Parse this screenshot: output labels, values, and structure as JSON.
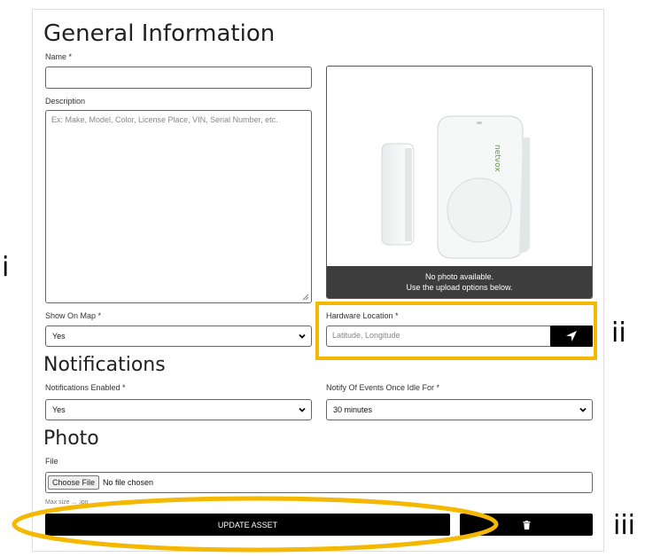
{
  "general": {
    "title": "General Information",
    "name_label": "Name *",
    "name_value": "",
    "description_label": "Description",
    "description_placeholder": "Ex: Make, Model, Color, License Place, VIN, Serial Number, etc.",
    "photo_caption_line1": "No photo available.",
    "photo_caption_line2": "Use the upload options below.",
    "show_on_map_label": "Show On Map *",
    "show_on_map_value": "Yes",
    "hardware_location_label": "Hardware Location *",
    "hardware_location_placeholder": "Latitude, Longitude"
  },
  "notifications": {
    "title": "Notifications",
    "enabled_label": "Notifications Enabled *",
    "enabled_value": "Yes",
    "idle_label": "Notify Of Events Once Idle For *",
    "idle_value": "30 minutes"
  },
  "photo": {
    "title": "Photo",
    "file_label": "File",
    "choose_file_label": "Choose File",
    "no_file_text": "No file chosen",
    "max_size_note": "Max size ... .jpg"
  },
  "actions": {
    "update_label": "UPDATE ASSET"
  },
  "markers": {
    "i": "i",
    "ii": "ii",
    "iii": "iii"
  },
  "device_brand": "netvox",
  "colors": {
    "highlight": "#F5B800",
    "button": "#000000",
    "overlay": "#3d3d3d"
  }
}
